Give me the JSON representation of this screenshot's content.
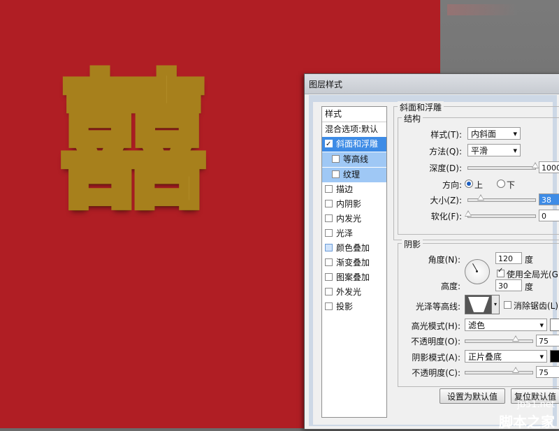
{
  "artwork": {
    "text": "囍"
  },
  "dialog": {
    "title": "图层样式",
    "styles_header": "样式",
    "blend_item": "混合选项:默认",
    "items": [
      {
        "label": "斜面和浮雕",
        "checked": true
      },
      {
        "label": "等高线",
        "checked": false
      },
      {
        "label": "纹理",
        "checked": false
      },
      {
        "label": "描边",
        "checked": false
      },
      {
        "label": "内阴影",
        "checked": false
      },
      {
        "label": "内发光",
        "checked": false
      },
      {
        "label": "光泽",
        "checked": false
      },
      {
        "label": "颜色叠加",
        "checked": false
      },
      {
        "label": "渐变叠加",
        "checked": false
      },
      {
        "label": "图案叠加",
        "checked": false
      },
      {
        "label": "外发光",
        "checked": false
      },
      {
        "label": "投影",
        "checked": false
      }
    ],
    "bevel": {
      "section_title": "斜面和浮雕",
      "structure_title": "结构",
      "style_label": "样式(T):",
      "style_value": "内斜面",
      "technique_label": "方法(Q):",
      "technique_value": "平滑",
      "depth_label": "深度(D):",
      "depth_value": "1000",
      "depth_pct": 1.0,
      "direction_label": "方向:",
      "direction_up": "上",
      "direction_down": "下",
      "size_label": "大小(Z):",
      "size_value": "38",
      "size_pct": 0.19,
      "soften_label": "软化(F):",
      "soften_value": "0",
      "soften_pct": 0.0
    },
    "shading": {
      "title": "阴影",
      "angle_label": "角度(N):",
      "angle_value": "120",
      "degree_unit": "度",
      "global_light_label": "使用全局光(G)",
      "global_light_checked": true,
      "altitude_label": "高度:",
      "altitude_value": "30",
      "gloss_label": "光泽等高线:",
      "antialias_label": "消除锯齿(L)",
      "antialias_checked": false,
      "highlight_mode_label": "高光模式(H):",
      "highlight_mode_value": "滤色",
      "highlight_color": "#ffffff",
      "highlight_opacity_label": "不透明度(O):",
      "highlight_opacity_value": "75",
      "highlight_opacity_pct": 0.75,
      "shadow_mode_label": "阴影模式(A):",
      "shadow_mode_value": "正片叠底",
      "shadow_color": "#000000",
      "shadow_opacity_label": "不透明度(C):",
      "shadow_opacity_value": "75",
      "shadow_opacity_pct": 0.75
    },
    "buttons": {
      "make_default": "设置为默认值",
      "reset": "复位默认值"
    }
  },
  "watermark": {
    "line1": "jb51.net",
    "line2": "脚本之家"
  }
}
